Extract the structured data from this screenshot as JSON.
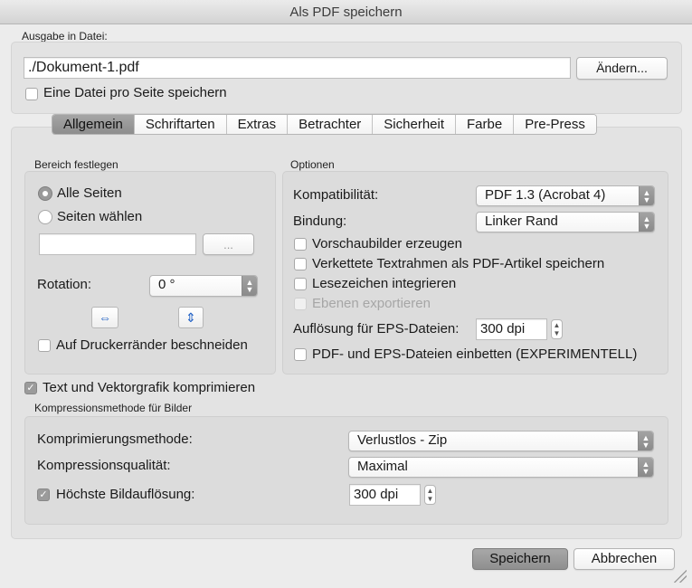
{
  "window": {
    "title": "Als PDF speichern"
  },
  "output": {
    "label": "Ausgabe in Datei:",
    "file_value": "./Dokument-1.pdf",
    "change_button": "Ändern...",
    "one_file_per_page": "Eine Datei pro Seite speichern"
  },
  "tabs": [
    "Allgemein",
    "Schriftarten",
    "Extras",
    "Betrachter",
    "Sicherheit",
    "Farbe",
    "Pre-Press"
  ],
  "range": {
    "title": "Bereich festlegen",
    "all_pages": "Alle Seiten",
    "choose_pages": "Seiten wählen",
    "pages_value": "",
    "browse_button": "...",
    "rotation_label": "Rotation:",
    "rotation_value": "0 °",
    "crop_label": "Auf Druckerränder beschneiden"
  },
  "options": {
    "title": "Optionen",
    "compat_label": "Kompatibilität:",
    "compat_value": "PDF 1.3 (Acrobat 4)",
    "binding_label": "Bindung:",
    "binding_value": "Linker Rand",
    "thumbnails": "Vorschaubilder erzeugen",
    "articles": "Verkettete Textrahmen als PDF-Artikel speichern",
    "bookmarks": "Lesezeichen integrieren",
    "layers": "Ebenen exportieren",
    "eps_res_label": "Auflösung für EPS-Dateien:",
    "eps_res_value": "300 dpi",
    "embed": "PDF- und EPS-Dateien einbetten (EXPERIMENTELL)"
  },
  "compress": {
    "text_vector": "Text und Vektorgrafik komprimieren",
    "images_title": "Kompressionsmethode für Bilder",
    "method_label": "Komprimierungsmethode:",
    "method_value": "Verlustlos - Zip",
    "quality_label": "Kompressionsqualität:",
    "quality_value": "Maximal",
    "max_res_label": "Höchste Bildauflösung:",
    "max_res_value": "300 dpi"
  },
  "footer": {
    "save": "Speichern",
    "cancel": "Abbrechen"
  }
}
